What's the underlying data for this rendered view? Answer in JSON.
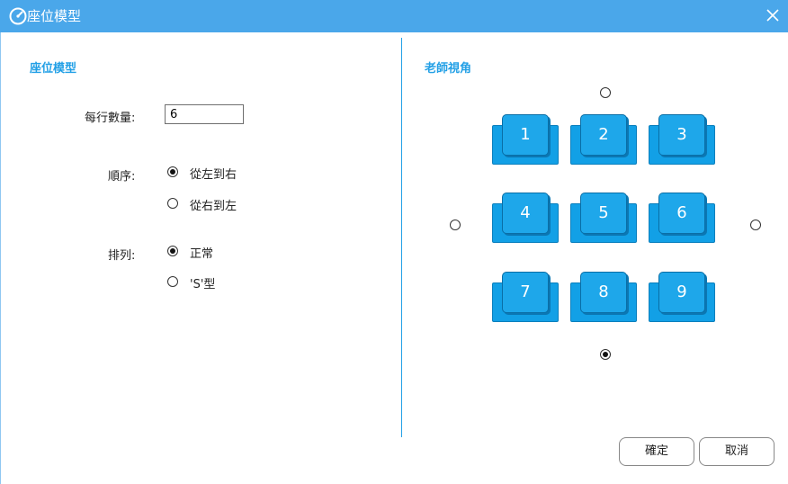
{
  "window": {
    "title": "座位模型"
  },
  "left_panel": {
    "section_title": "座位模型",
    "per_row": {
      "label": "每行數量:",
      "value": "6"
    },
    "order": {
      "label": "順序:",
      "options": [
        "從左到右",
        "從右到左"
      ],
      "selected": 0
    },
    "arrange": {
      "label": "排列:",
      "options": [
        "正常",
        "'S'型"
      ],
      "selected": 0
    }
  },
  "right_panel": {
    "section_title": "老師視角",
    "seats": [
      "1",
      "2",
      "3",
      "4",
      "5",
      "6",
      "7",
      "8",
      "9"
    ],
    "teacher_position_selected": "bottom"
  },
  "buttons": {
    "ok": "確定",
    "cancel": "取消"
  },
  "colors": {
    "titlebar": "#4aa7ea",
    "accent": "#23a0e6",
    "seat": "#12a0e6"
  },
  "icons": {
    "title_icon": "gauge-icon",
    "close": "close-icon"
  }
}
